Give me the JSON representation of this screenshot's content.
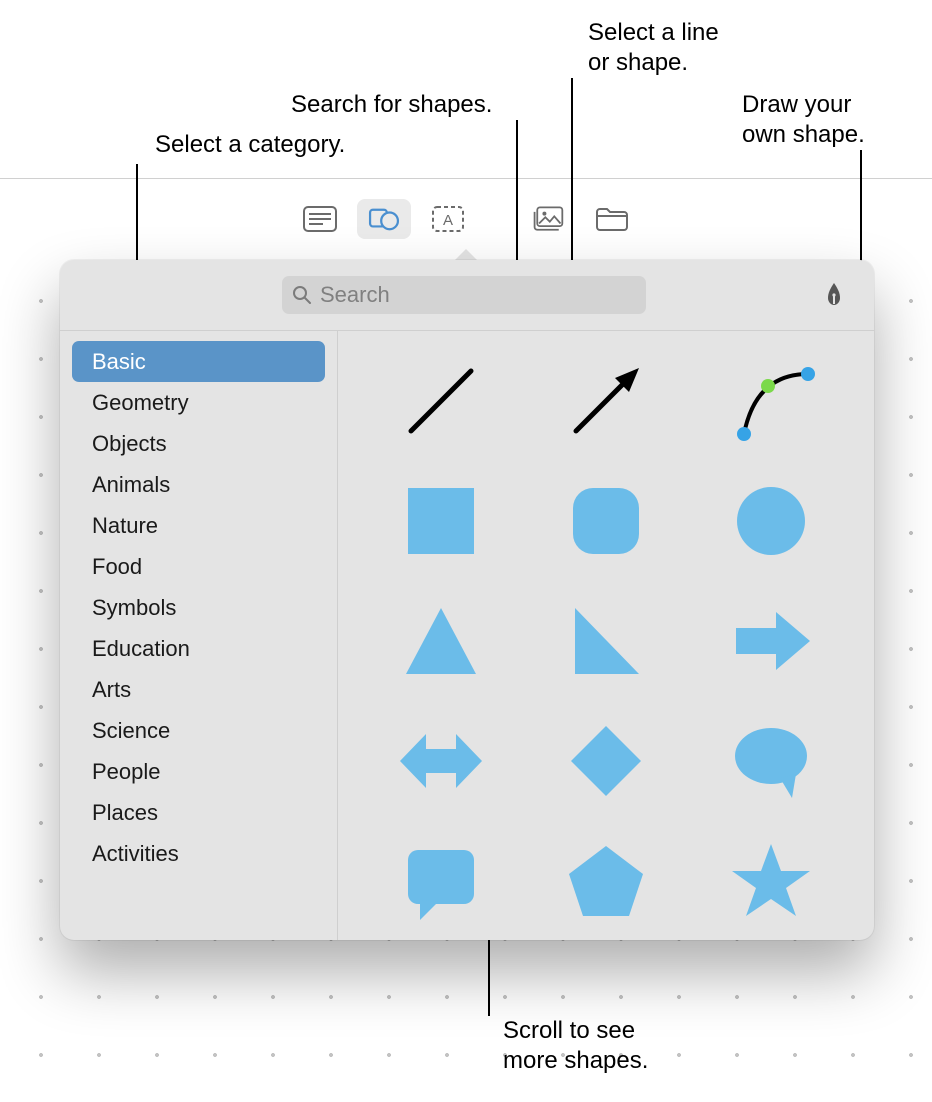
{
  "callouts": {
    "category": "Select a category.",
    "search": "Search for shapes.",
    "select_line1": "Select a line",
    "select_line2": "or shape.",
    "draw_line1": "Draw your",
    "draw_line2": "own shape.",
    "scroll_line1": "Scroll to see",
    "scroll_line2": "more shapes."
  },
  "toolbar": {
    "items": [
      {
        "name": "page-layout-icon"
      },
      {
        "name": "shapes-icon",
        "active": true
      },
      {
        "name": "textbox-icon"
      },
      {
        "name": "media-icon"
      },
      {
        "name": "folder-icon"
      }
    ]
  },
  "search": {
    "placeholder": "Search"
  },
  "sidebar": {
    "items": [
      {
        "label": "Basic",
        "selected": true
      },
      {
        "label": "Geometry"
      },
      {
        "label": "Objects"
      },
      {
        "label": "Animals"
      },
      {
        "label": "Nature"
      },
      {
        "label": "Food"
      },
      {
        "label": "Symbols"
      },
      {
        "label": "Education"
      },
      {
        "label": "Arts"
      },
      {
        "label": "Science"
      },
      {
        "label": "People"
      },
      {
        "label": "Places"
      },
      {
        "label": "Activities"
      }
    ]
  },
  "shapes": {
    "items": [
      {
        "name": "line-shape"
      },
      {
        "name": "arrow-line-shape"
      },
      {
        "name": "curve-editable-shape"
      },
      {
        "name": "square-shape"
      },
      {
        "name": "rounded-square-shape"
      },
      {
        "name": "circle-shape"
      },
      {
        "name": "triangle-shape"
      },
      {
        "name": "right-triangle-shape"
      },
      {
        "name": "right-arrow-shape"
      },
      {
        "name": "double-arrow-shape"
      },
      {
        "name": "diamond-shape"
      },
      {
        "name": "speech-bubble-shape"
      },
      {
        "name": "quote-bubble-shape"
      },
      {
        "name": "pentagon-shape"
      },
      {
        "name": "star-shape"
      }
    ]
  },
  "colors": {
    "accent": "#6bbce9",
    "selection": "#5a94c8"
  }
}
